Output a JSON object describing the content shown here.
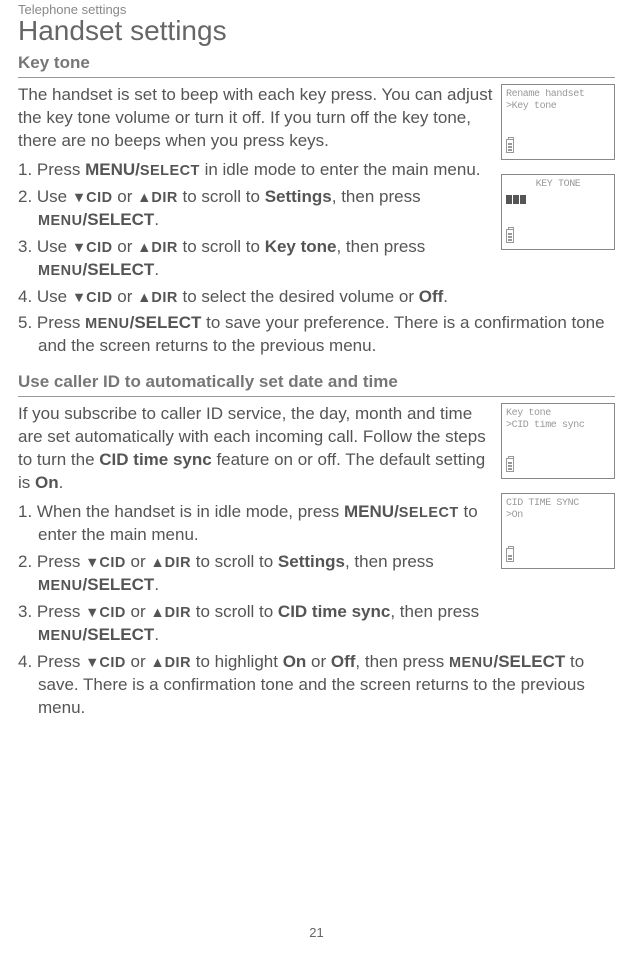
{
  "breadcrumb": "Telephone settings",
  "page_title": "Handset settings",
  "page_number": "21",
  "keys": {
    "menu_select": "MENU/",
    "select_sc": "SELECT",
    "menu_sc": "MENU",
    "select_full": "/SELECT",
    "cid": "CID",
    "dir": "DIR",
    "down": "▼",
    "up": "▲"
  },
  "section1": {
    "title": "Key tone",
    "intro": "The handset is set to beep with each key press. You can adjust the key tone volume or turn it off. If you turn off the key tone, there are no beeps when you press keys.",
    "steps": {
      "s1a": "1. Press ",
      "s1b": " in idle mode to enter the main menu.",
      "s2a": "2. Use ",
      "s2mid": " or ",
      "s2b": " to scroll to ",
      "s2target": "Settings",
      "s2c": ", then press ",
      "period": ".",
      "s3target": "Key tone",
      "s4a": "4. Use ",
      "s4b": " to select the desired volume or ",
      "s4off": "Off",
      "s5a": "5. Press ",
      "s5b": " to save your preference. There is a confirmation tone and the screen returns to the previous menu.",
      "s3a": "3. Use "
    },
    "lcd1": {
      "l1": " Rename handset",
      "l2": ">Key tone"
    },
    "lcd2": {
      "l1": "KEY TONE"
    }
  },
  "section2": {
    "title": "Use caller ID to automatically set date and time",
    "intro_a": "If you subscribe to caller ID service, the day, month and time are set automatically with each incoming call. Follow the steps to turn the ",
    "intro_b": "CID time sync",
    "intro_c": " feature on or off. The default setting is ",
    "intro_on": "On",
    "steps": {
      "s1a": "1. When the handset is in idle mode, press ",
      "s1b": " to enter the main menu.",
      "s2a": "2. Press ",
      "s2mid": " or ",
      "s2b": " to scroll to ",
      "s2target": "Settings",
      "s2c": ", then press ",
      "s3a": "3. Press ",
      "s3target": "CID time sync",
      "s3c": ", then press ",
      "s4a": "4. Press ",
      "s4b": " to highlight ",
      "s4on": "On",
      "s4or": " or ",
      "s4off": "Off",
      "s4c": ", then press ",
      "s4d": " to save. There is a confirmation tone and the screen returns to the previous menu.",
      "period": "."
    },
    "lcd1": {
      "l1": " Key tone",
      "l2": ">CID time sync"
    },
    "lcd2": {
      "l1": " CID TIME SYNC",
      "l2": ">On"
    }
  }
}
